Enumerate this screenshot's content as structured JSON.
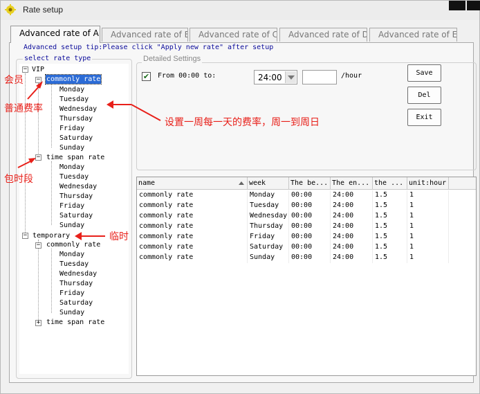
{
  "window": {
    "title": "Rate setup"
  },
  "tabs": [
    "Advanced rate of A",
    "Advanced rate of B",
    "Advanced rate of C",
    "Advanced rate of D",
    "Advanced rate of E"
  ],
  "tip": "Advanced setup tip:Please click \"Apply new rate\" after setup",
  "tree": {
    "title": "select rate type",
    "vip": "VIP",
    "temporary": "temporary",
    "commonly_rate": "commonly rate",
    "time_span_rate": "time span rate",
    "days": [
      "Monday",
      "Tuesday",
      "Wednesday",
      "Thursday",
      "Friday",
      "Saturday",
      "Sunday"
    ],
    "expand_minus": "−",
    "expand_plus": "+"
  },
  "settings": {
    "title": "Detailed Settings",
    "checked_mark": "✔",
    "from_label": "From 00:00 to:",
    "to_value": "24:00",
    "unit": "/hour"
  },
  "buttons": {
    "save": "Save",
    "del": "Del",
    "exit": "Exit"
  },
  "grid": {
    "columns": [
      "name",
      "week",
      "The be...",
      "The en...",
      "the ...",
      "unit:hour"
    ],
    "rows": [
      [
        "commonly rate",
        "Monday",
        "00:00",
        "24:00",
        "1.5",
        "1"
      ],
      [
        "commonly rate",
        "Tuesday",
        "00:00",
        "24:00",
        "1.5",
        "1"
      ],
      [
        "commonly rate",
        "Wednesday",
        "00:00",
        "24:00",
        "1.5",
        "1"
      ],
      [
        "commonly rate",
        "Thursday",
        "00:00",
        "24:00",
        "1.5",
        "1"
      ],
      [
        "commonly rate",
        "Friday",
        "00:00",
        "24:00",
        "1.5",
        "1"
      ],
      [
        "commonly rate",
        "Saturday",
        "00:00",
        "24:00",
        "1.5",
        "1"
      ],
      [
        "commonly rate",
        "Sunday",
        "00:00",
        "24:00",
        "1.5",
        "1"
      ]
    ]
  },
  "annotations": {
    "member": "会员",
    "normal_rate": "普通费率",
    "weekly_note": "设置一周每一天的费率，周一到周日",
    "period": "包时段",
    "temporary": "临时"
  },
  "colors": {
    "annotation": "#e8201a",
    "tip_text": "#0a0a9a",
    "selection": "#2b6bd6"
  }
}
